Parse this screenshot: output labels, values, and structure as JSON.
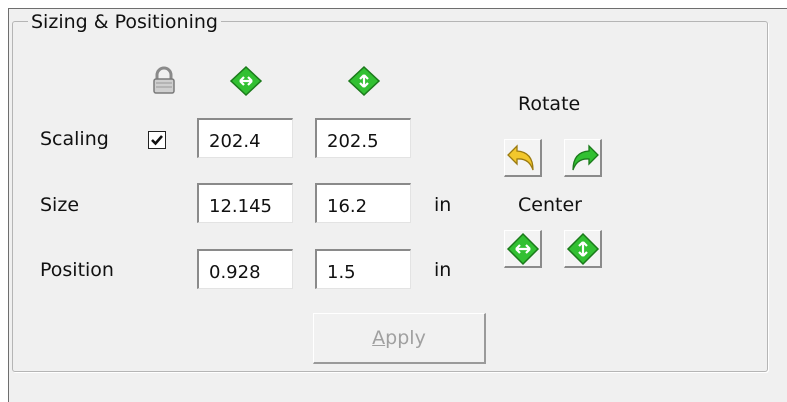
{
  "group": {
    "title": "Sizing & Positioning"
  },
  "headers": {
    "lock_icon": "lock-icon",
    "width_icon": "resize-horizontal-icon",
    "height_icon": "resize-vertical-icon"
  },
  "rows": {
    "scaling": {
      "label": "Scaling",
      "checked": true,
      "width": "202.4",
      "height": "202.5"
    },
    "size": {
      "label": "Size",
      "width": "12.145",
      "height": "16.2",
      "unit": "in"
    },
    "position": {
      "label": "Position",
      "width": "0.928",
      "height": "1.5",
      "unit": "in"
    }
  },
  "rotate": {
    "label": "Rotate"
  },
  "center": {
    "label": "Center"
  },
  "apply": {
    "label_first": "A",
    "label_rest": "pply",
    "enabled": false
  },
  "colors": {
    "accent_green": "#32c032",
    "accent_yellow": "#f2c72c",
    "disabled_text": "#a0a0a0"
  }
}
